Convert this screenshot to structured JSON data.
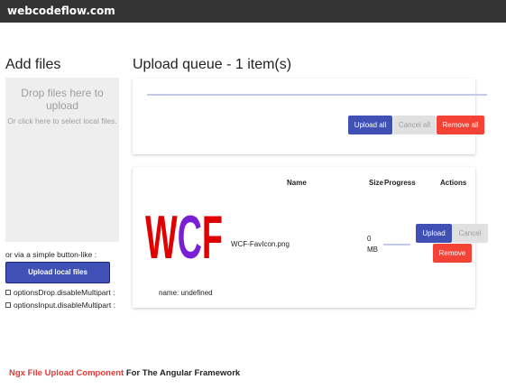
{
  "topbar": {
    "brand": "webcodeflow.com"
  },
  "add_files": {
    "title": "Add files",
    "drop_title": "Drop files here to upload",
    "drop_sub": "Or click here to select local files.",
    "alt_text": "or via a simple button-like :",
    "upload_local_label": "Upload local files",
    "checkboxes": [
      {
        "label": "optionsDrop.disableMultipart :",
        "checked": false
      },
      {
        "label": "optionsInput.disableMultipart :",
        "checked": false
      }
    ]
  },
  "queue": {
    "title": "Upload queue - 1 item(s)",
    "upload_all": "Upload all",
    "cancel_all": "Cancel all",
    "remove_all": "Remove all",
    "progress": 0
  },
  "table": {
    "headers": {
      "name": "Name",
      "size": "Size",
      "progress": "Progress",
      "actions": "Actions"
    },
    "item": {
      "thumb_text": "WCF",
      "filename": "WCF-FavIcon.png",
      "size_value": "0",
      "size_unit": "MB",
      "progress": 0,
      "upload": "Upload",
      "cancel": "Cancel",
      "remove": "Remove",
      "meta": "name: undefined"
    }
  },
  "footer": {
    "highlight": "Ngx File Upload Component",
    "rest": " For The Angular Framework"
  },
  "colors": {
    "primary": "#3f51b5",
    "danger": "#f44336",
    "disabled": "#e0e0e0",
    "topbar": "#333333"
  }
}
